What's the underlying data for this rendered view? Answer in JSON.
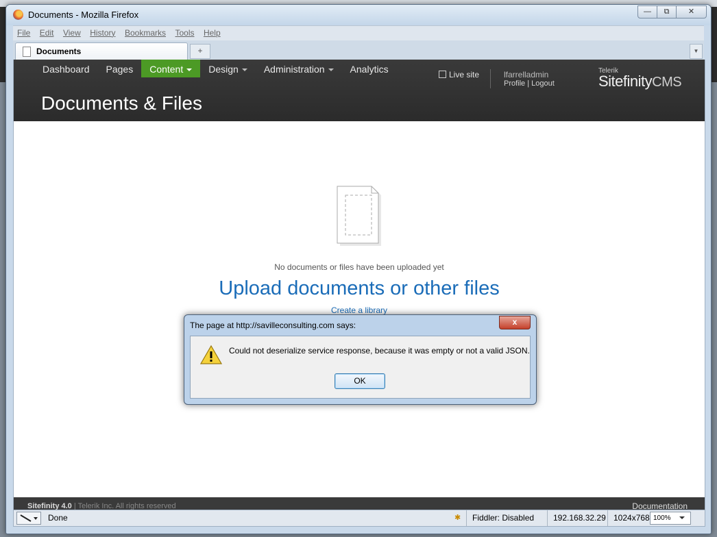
{
  "window": {
    "title": "Documents - Mozilla Firefox",
    "controls": {
      "minimize": "—",
      "restore": "⧉",
      "close": "✕"
    }
  },
  "menu": [
    "File",
    "Edit",
    "View",
    "History",
    "Bookmarks",
    "Tools",
    "Help"
  ],
  "tab": {
    "label": "Documents",
    "new_tab": "+",
    "list": "▼"
  },
  "sitefinity": {
    "nav": [
      {
        "label": "Dashboard",
        "has_menu": false,
        "active": false
      },
      {
        "label": "Pages",
        "has_menu": false,
        "active": false
      },
      {
        "label": "Content",
        "has_menu": true,
        "active": true
      },
      {
        "label": "Design",
        "has_menu": true,
        "active": false
      },
      {
        "label": "Administration",
        "has_menu": true,
        "active": false
      },
      {
        "label": "Analytics",
        "has_menu": false,
        "active": false
      }
    ],
    "live_site": "Live site",
    "user": "lfarrelladmin",
    "profile": "Profile",
    "logout": "Logout",
    "brand_vendor": "Telerik",
    "brand_name": "Sitefinity",
    "brand_suffix": "CMS",
    "page_title": "Documents & Files",
    "empty_message": "No documents or files have been uploaded yet",
    "upload_link": "Upload documents or other files",
    "create_library": "Create a library",
    "footer_product": "Sitefinity 4.0",
    "footer_copyright": "| Telerik Inc. All rights reserved",
    "footer_doc": "Documentation"
  },
  "statusbar": {
    "status": "Done",
    "fiddler": "Fiddler: Disabled",
    "ip": "192.168.32.29",
    "resolution": "1024x768",
    "zoom": "100%"
  },
  "dialog": {
    "title": "The page at http://savilleconsulting.com says:",
    "message": "Could not deserialize service response, because it was empty or not a valid JSON.",
    "ok": "OK",
    "close": "x"
  }
}
